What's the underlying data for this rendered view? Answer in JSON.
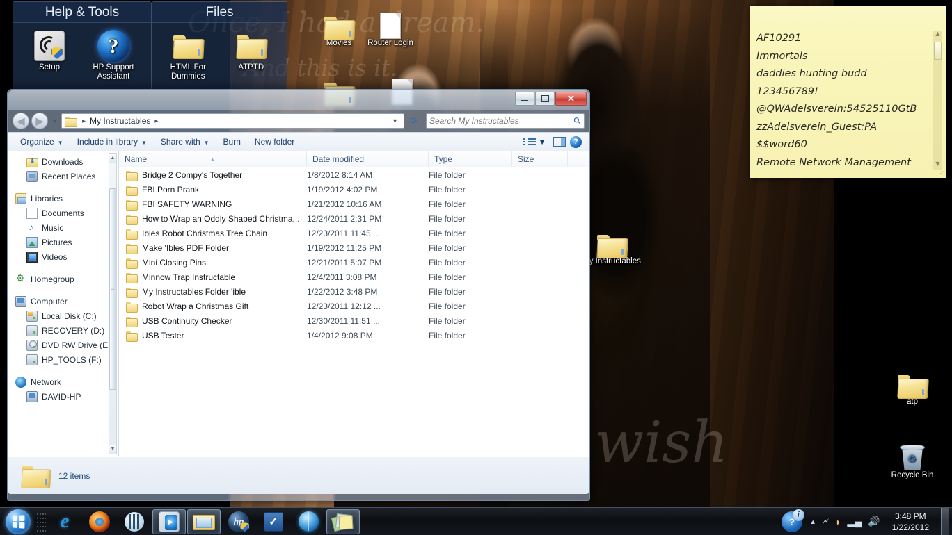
{
  "desktop": {
    "wallpaper_script_lines": [
      "Once, I had a dream.",
      "And this is it.",
      "wish"
    ],
    "fences": [
      {
        "title": "Help & Tools",
        "items": [
          {
            "label": "Setup",
            "icon": "setup-icon"
          },
          {
            "label": "HP Support Assistant",
            "icon": "question-orb-icon"
          }
        ]
      },
      {
        "title": "Files",
        "items": [
          {
            "label": "HTML For Dummies",
            "icon": "folder-icon"
          },
          {
            "label": "ATPTD",
            "icon": "folder-icon"
          }
        ]
      }
    ],
    "icons": [
      {
        "label": "Movies",
        "icon": "folder-icon"
      },
      {
        "label": "Router Login",
        "icon": "document-icon"
      },
      {
        "label": "My Instructables",
        "icon": "folder-icon"
      },
      {
        "label": "atp",
        "icon": "folder-icon"
      },
      {
        "label": "Recycle Bin",
        "icon": "recycle-bin-icon"
      }
    ]
  },
  "sticky_note": {
    "lines": [
      "AF10291",
      "Immortals",
      "daddies hunting budd",
      "123456789!",
      "@QWAdelsverein:54525110GtB",
      "zzAdelsverein_Guest:PA",
      "$$word60",
      "Remote Network Management"
    ]
  },
  "explorer": {
    "address": {
      "path_label": "My Instructables",
      "separator": "▸"
    },
    "search": {
      "placeholder": "Search My Instructables",
      "value": ""
    },
    "nav_buttons": {
      "back": "◀",
      "forward": "▶",
      "history": "▾",
      "refresh": "↵"
    },
    "toolbar": [
      {
        "label": "Organize",
        "has_caret": true
      },
      {
        "label": "Include in library",
        "has_caret": true
      },
      {
        "label": "Share with",
        "has_caret": true
      },
      {
        "label": "Burn",
        "has_caret": false
      },
      {
        "label": "New folder",
        "has_caret": false
      }
    ],
    "navpane": [
      {
        "label": "Downloads",
        "icon": "folder-download-icon",
        "level": "child"
      },
      {
        "label": "Recent Places",
        "icon": "recent-places-icon",
        "level": "child"
      },
      {
        "gap": true
      },
      {
        "label": "Libraries",
        "icon": "libraries-icon",
        "level": "root"
      },
      {
        "label": "Documents",
        "icon": "documents-icon",
        "level": "child"
      },
      {
        "label": "Music",
        "icon": "music-icon",
        "level": "child"
      },
      {
        "label": "Pictures",
        "icon": "pictures-icon",
        "level": "child"
      },
      {
        "label": "Videos",
        "icon": "videos-icon",
        "level": "child"
      },
      {
        "gap": true
      },
      {
        "label": "Homegroup",
        "icon": "homegroup-icon",
        "level": "root"
      },
      {
        "gap": true
      },
      {
        "label": "Computer",
        "icon": "computer-icon",
        "level": "root"
      },
      {
        "label": "Local Disk (C:)",
        "icon": "harddisk-icon",
        "level": "child"
      },
      {
        "label": "RECOVERY (D:)",
        "icon": "drive-icon",
        "level": "child"
      },
      {
        "label": "DVD RW Drive (E:",
        "icon": "dvd-drive-icon",
        "level": "child"
      },
      {
        "label": "HP_TOOLS (F:)",
        "icon": "drive-icon",
        "level": "child"
      },
      {
        "gap": true
      },
      {
        "label": "Network",
        "icon": "network-icon",
        "level": "root"
      },
      {
        "label": "DAVID-HP",
        "icon": "computer-icon",
        "level": "child"
      }
    ],
    "columns": [
      {
        "key": "name",
        "label": "Name",
        "sorted": "asc"
      },
      {
        "key": "date",
        "label": "Date modified",
        "sorted": ""
      },
      {
        "key": "type",
        "label": "Type",
        "sorted": ""
      },
      {
        "key": "size",
        "label": "Size",
        "sorted": ""
      }
    ],
    "files": [
      {
        "name": "Bridge 2 Compy's Together",
        "date": "1/8/2012 8:14 AM",
        "type": "File folder",
        "size": ""
      },
      {
        "name": "FBI Porn Prank",
        "date": "1/19/2012 4:02 PM",
        "type": "File folder",
        "size": ""
      },
      {
        "name": "FBI SAFETY WARNING",
        "date": "1/21/2012 10:16 AM",
        "type": "File folder",
        "size": ""
      },
      {
        "name": "How to Wrap an Oddly Shaped Christma...",
        "date": "12/24/2011 2:31 PM",
        "type": "File folder",
        "size": ""
      },
      {
        "name": "Ibles Robot Christmas Tree Chain",
        "date": "12/23/2011 11:45 ...",
        "type": "File folder",
        "size": ""
      },
      {
        "name": "Make 'Ibles PDF Folder",
        "date": "1/19/2012 11:25 PM",
        "type": "File folder",
        "size": ""
      },
      {
        "name": "Mini Closing Pins",
        "date": "12/21/2011 5:07 PM",
        "type": "File folder",
        "size": ""
      },
      {
        "name": "Minnow Trap Instructable",
        "date": "12/4/2011 3:08 PM",
        "type": "File folder",
        "size": ""
      },
      {
        "name": "My Instructables Folder 'ible",
        "date": "1/22/2012 3:48 PM",
        "type": "File folder",
        "size": ""
      },
      {
        "name": "Robot Wrap a Christmas Gift",
        "date": "12/23/2011 12:12 ...",
        "type": "File folder",
        "size": ""
      },
      {
        "name": "USB Continuity Checker",
        "date": "12/30/2011 11:51 ...",
        "type": "File folder",
        "size": ""
      },
      {
        "name": "USB Tester",
        "date": "1/4/2012 9:08 PM",
        "type": "File folder",
        "size": ""
      }
    ],
    "status": {
      "item_count": "12 items"
    },
    "window_controls": {
      "minimize": "",
      "maximize": "",
      "close": "✕"
    }
  },
  "taskbar": {
    "start_label": "Start",
    "buttons": [
      {
        "name": "internet-explorer",
        "active": false
      },
      {
        "name": "firefox",
        "active": false
      },
      {
        "name": "bittorrent",
        "active": false
      },
      {
        "name": "windows-media-player",
        "active": true
      },
      {
        "name": "windows-explorer",
        "active": true
      },
      {
        "name": "hp-support",
        "active": false
      },
      {
        "name": "checkmark-app",
        "active": false
      },
      {
        "name": "globe-app",
        "active": false
      },
      {
        "name": "sticky-notes",
        "active": true
      }
    ],
    "tray": {
      "action_center_label": "i",
      "show_hidden": "▲",
      "icons": [
        "safely-remove-hardware",
        "weather",
        "network",
        "volume"
      ]
    },
    "clock": {
      "time": "3:48 PM",
      "date": "1/22/2012"
    }
  }
}
